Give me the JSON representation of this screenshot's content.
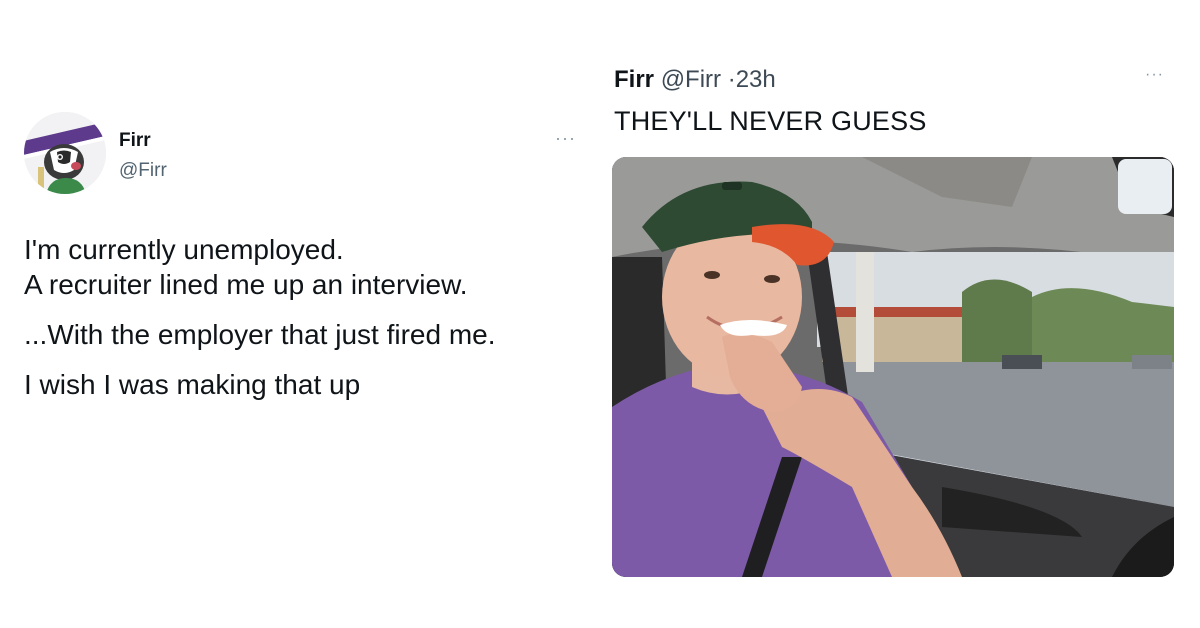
{
  "left_tweet": {
    "author_name": "Firr",
    "author_handle": "@Firr",
    "more_label": "···",
    "paragraphs": [
      "I'm currently unemployed.\nA recruiter lined me up an interview.",
      "...With the employer that just fired me.",
      "I wish I was making that up"
    ]
  },
  "right_tweet": {
    "author_name": "Firr",
    "author_handle": "@Firr",
    "separator": "·",
    "time": "23h",
    "more_label": "···",
    "text": "THEY'LL NEVER GUESS",
    "image_icon": "photo-man-in-car-with-fake-mustache"
  }
}
